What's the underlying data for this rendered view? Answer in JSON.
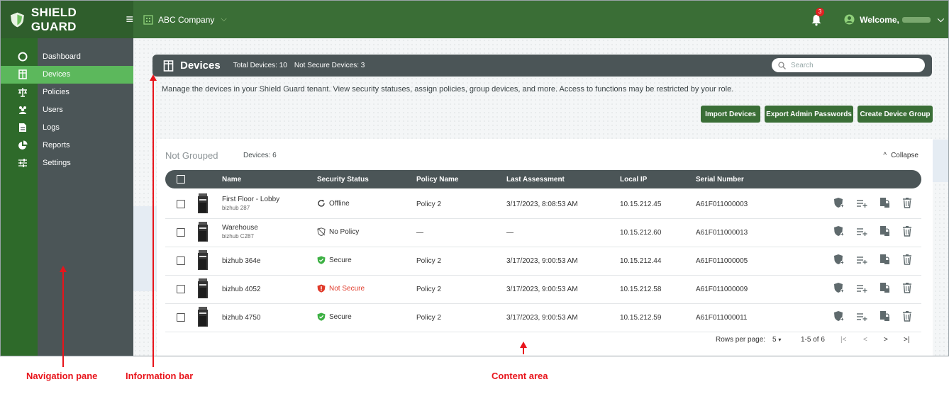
{
  "app": {
    "brand": "SHIELD GUARD",
    "company": "ABC Company",
    "notification_count": "3",
    "welcome": "Welcome,"
  },
  "sidebar": {
    "items": [
      {
        "label": "Dashboard",
        "icon": "dashboard-icon"
      },
      {
        "label": "Devices",
        "icon": "devices-icon",
        "active": true
      },
      {
        "label": "Policies",
        "icon": "scale-icon"
      },
      {
        "label": "Users",
        "icon": "users-icon"
      },
      {
        "label": "Logs",
        "icon": "document-icon"
      },
      {
        "label": "Reports",
        "icon": "pie-chart-icon"
      },
      {
        "label": "Settings",
        "icon": "sliders-icon"
      }
    ]
  },
  "infobar": {
    "title": "Devices",
    "total": "Total Devices: 10",
    "not_secure": "Not Secure Devices: 3",
    "search_placeholder": "Search"
  },
  "description": "Manage the devices in your Shield Guard tenant. View security statuses, assign policies, group devices, and more. Access to functions may be restricted by your role.",
  "actions": {
    "import": "Import Devices",
    "export": "Export Admin Passwords",
    "create_group": "Create Device Group"
  },
  "group": {
    "title": "Not Grouped",
    "count": "Devices: 6",
    "collapse": "Collapse"
  },
  "table": {
    "columns": [
      "Name",
      "Security Status",
      "Policy Name",
      "Last Assessment",
      "Local IP",
      "Serial Number"
    ],
    "rows": [
      {
        "name": "First Floor - Lobby",
        "model": "bizhub 287",
        "status": "Offline",
        "policy": "Policy 2",
        "assessed": "3/17/2023, 8:08:53 AM",
        "ip": "10.15.212.45",
        "serial": "A61F011000003"
      },
      {
        "name": "Warehouse",
        "model": "bizhub C287",
        "status": "No Policy",
        "policy": "—",
        "assessed": "—",
        "ip": "10.15.212.60",
        "serial": "A61F011000013"
      },
      {
        "name": "bizhub 364e",
        "model": "",
        "status": "Secure",
        "policy": "Policy 2",
        "assessed": "3/17/2023, 9:00:53 AM",
        "ip": "10.15.212.44",
        "serial": "A61F011000005"
      },
      {
        "name": "bizhub 4052",
        "model": "",
        "status": "Not Secure",
        "policy": "Policy 2",
        "assessed": "3/17/2023, 9:00:53 AM",
        "ip": "10.15.212.58",
        "serial": "A61F011000009"
      },
      {
        "name": "bizhub 4750",
        "model": "",
        "status": "Secure",
        "policy": "Policy 2",
        "assessed": "3/17/2023, 9:00:53 AM",
        "ip": "10.15.212.59",
        "serial": "A61F011000011"
      }
    ]
  },
  "pager": {
    "rows_per_page_label": "Rows per page:",
    "rows_per_page": "5",
    "range": "1-5 of 6"
  },
  "annotations": {
    "navigation": "Navigation pane",
    "information": "Information bar",
    "content": "Content area"
  },
  "colors": {
    "topbar": "#3a6e36",
    "active_nav": "#5cb85c",
    "infobar": "#4b5557",
    "button": "#3a6e36",
    "not_secure": "#e03a2a",
    "secure": "#3cb043",
    "annotation": "#e8141b"
  }
}
